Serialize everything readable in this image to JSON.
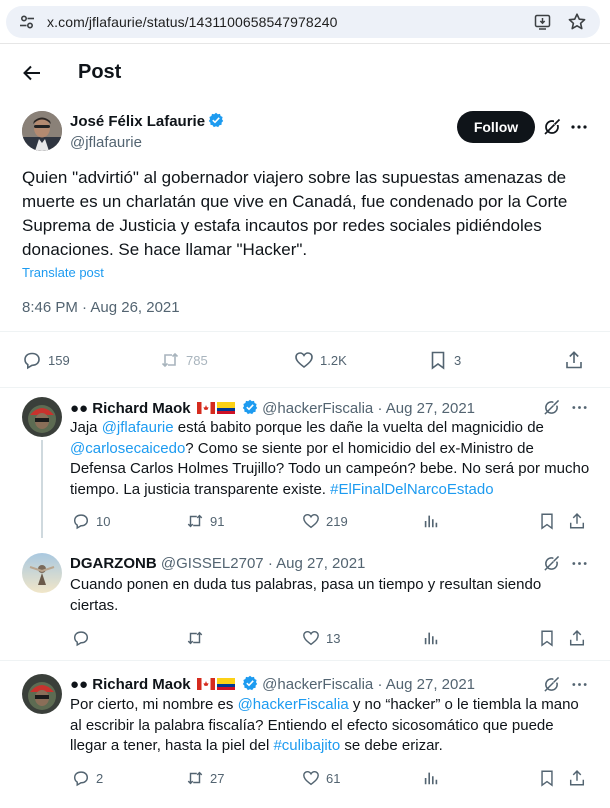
{
  "browser": {
    "url": "x.com/jflafaurie/status/1431100658547978240"
  },
  "header": {
    "title": "Post"
  },
  "main_post": {
    "author_name": "José Félix Lafaurie",
    "author_handle": "@jflafaurie",
    "follow_label": "Follow",
    "text": "Quien \"advirtió\" al gobernador viajero sobre las supuestas amenazas de muerte es un charlatán que vive en Canadá, fue condenado por la Corte Suprema de Justicia y estafa incautos por redes sociales pidiéndoles donaciones. Se hace llamar \"Hacker\".",
    "translate_label": "Translate post",
    "timestamp": "8:46 PM · Aug 26, 2021",
    "replies": "159",
    "reposts": "785",
    "likes": "1.2K",
    "bookmarks": "3"
  },
  "replies": [
    {
      "name": "●● Richard Maok",
      "handle": "@hackerFiscalia",
      "date": "Aug 27, 2021",
      "text_parts": {
        "t1": "Jaja ",
        "m1": "@jflafaurie",
        "t2": " está babito porque les dañe la vuelta del magnicidio de ",
        "m2": "@carlosecaicedo",
        "t3": "? Como se siente por el homicidio del ex-Ministro de Defensa Carlos Holmes Trujillo? Todo un campeón? bebe. No será por mucho tiempo. La justicia transparente existe. ",
        "m3": "#ElFinalDelNarcoEstado"
      },
      "replies": "10",
      "reposts": "91",
      "likes": "219"
    },
    {
      "name": "DGARZONB",
      "handle": "@GISSEL2707",
      "date": "Aug 27, 2021",
      "text": "Cuando ponen en duda tus palabras, pasa un tiempo y resultan siendo ciertas.",
      "likes": "13"
    },
    {
      "name": "●● Richard Maok",
      "handle": "@hackerFiscalia",
      "date": "Aug 27, 2021",
      "text_parts": {
        "t1": "Por cierto, mi nombre es ",
        "m1": "@hackerFiscalia",
        "t2": " y no “hacker” o le tiembla la mano al escribir la palabra fiscalía? Entiendo el efecto sicosomático que puede llegar a tener, hasta la piel del ",
        "m2": "#culibajito",
        "t3": " se debe erizar."
      },
      "replies": "2",
      "reposts": "27",
      "likes": "61"
    }
  ],
  "colors": {
    "accent": "#1d9bf0",
    "secondary_text": "#536471",
    "follow_bg": "#0f1419"
  }
}
